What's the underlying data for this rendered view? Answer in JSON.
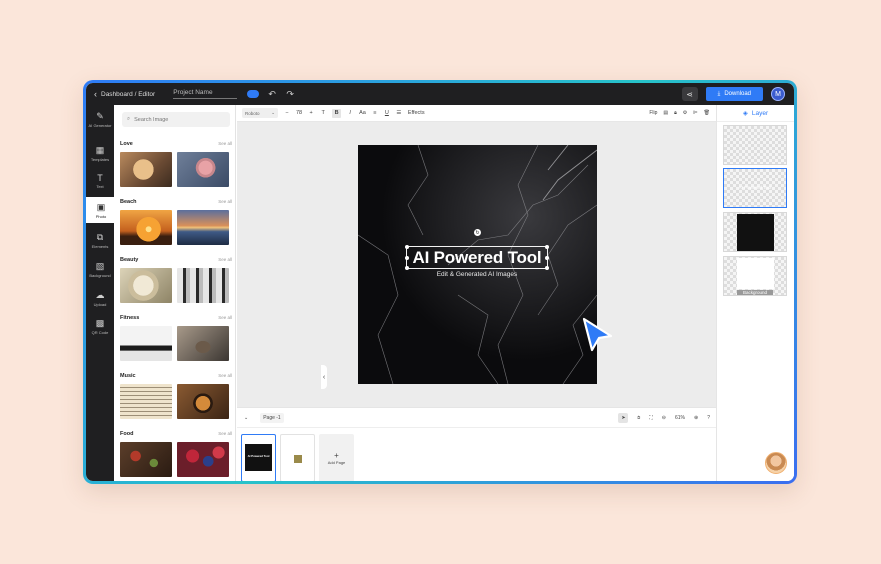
{
  "topbar": {
    "breadcrumb": "Dashboard / Editor",
    "project_name": "Project Name",
    "download_label": "Download",
    "avatar_initial": "M"
  },
  "rail": {
    "items": [
      {
        "label": "AI Generator",
        "icon": "ai-generator-icon"
      },
      {
        "label": "Templates",
        "icon": "templates-icon"
      },
      {
        "label": "Text",
        "icon": "text-icon"
      },
      {
        "label": "Photo",
        "icon": "photo-icon",
        "active": true
      },
      {
        "label": "Elements",
        "icon": "elements-icon"
      },
      {
        "label": "Background",
        "icon": "background-icon"
      },
      {
        "label": "Upload",
        "icon": "upload-icon"
      },
      {
        "label": "QR Code",
        "icon": "qr-code-icon"
      }
    ]
  },
  "panel": {
    "search_placeholder": "Search Image",
    "see_all": "See all",
    "categories": [
      "Love",
      "Beach",
      "Beauty",
      "Fitness",
      "Music",
      "Food"
    ]
  },
  "toolbar": {
    "font": "Roboto",
    "size": "78",
    "minus": "−",
    "plus": "+",
    "effects": "Effects",
    "flip": "Flip"
  },
  "canvas": {
    "headline": "AI Powered Tool",
    "subline": "Edit & Generated AI Images"
  },
  "pagebar": {
    "page_label": "Page -1",
    "zoom": "61%"
  },
  "pages": {
    "add_page": "Add Page",
    "thumb_title": "AI Powered Tool"
  },
  "layers": {
    "title": "Layer",
    "text_layer": "AI Powered Tool",
    "background_label": "Background"
  },
  "colors": {
    "accent": "#2f7bf6",
    "dark": "#1f1f21",
    "page_bg": "#fbe6da"
  }
}
